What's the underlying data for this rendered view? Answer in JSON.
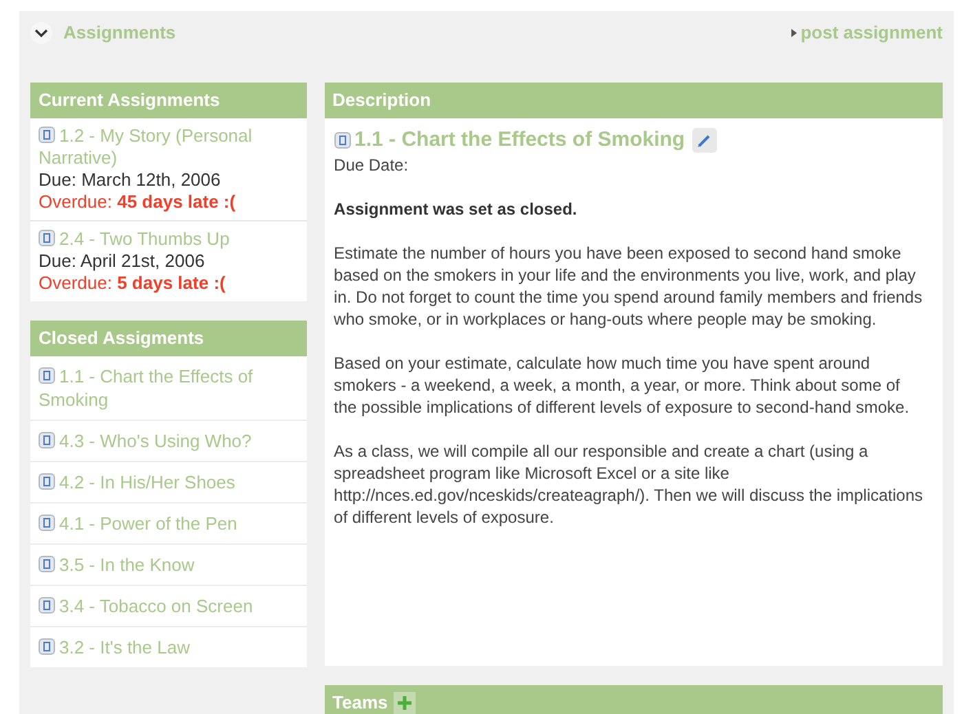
{
  "header": {
    "title": "Assignments",
    "expanded": true,
    "action": "post assignment"
  },
  "current": {
    "title": "Current Assignments",
    "items": [
      {
        "title": "1.2 - My Story (Personal Narrative)",
        "due": "Due: March 12th, 2006",
        "overdue": "Overdue: **45 days late :(**"
      },
      {
        "title": "2.4 - Two Thumbs Up",
        "due": "Due: April 21st, 2006",
        "overdue": "Overdue: **5 days late :(**"
      }
    ]
  },
  "closed": {
    "title": "Closed Assigments",
    "items": [
      {
        "title": "1.1 - Chart the Effects of Smoking"
      },
      {
        "title": "4.3 - Who's Using Who?"
      },
      {
        "title": "4.2 - In His/Her Shoes"
      },
      {
        "title": "4.1 - Power of the Pen"
      },
      {
        "title": "3.5 - In the Know"
      },
      {
        "title": "3.4 - Tobacco on Screen"
      },
      {
        "title": "3.2 - It's the Law"
      }
    ]
  },
  "description": {
    "title": "Description",
    "assignment": "1.1 - Chart the Effects of Smoking",
    "due": "Due Date:",
    "status": "Assignment was set as closed.",
    "paragraphs": [
      "Estimate the number of hours you have been exposed to second hand smoke based on the smokers in your life and the environments you live, work, and play in. Do not forget to count the time you spend around family members and friends who smoke, or in workplaces or hang-outs where people may be smoking.",
      "Based on your estimate, calculate how much time you have spent around smokers - a weekend, a week, a month, a year, or more. Think about some of the possible implications of different levels of exposure to second-hand smoke.",
      "As a class, we will compile all our responsible and create a chart (using a spreadsheet program like Microsoft Excel or a site like http://nces.ed.gov/nceskids/createagraph/). Then we will discuss the implications of different levels of exposure."
    ]
  },
  "teams": {
    "title": "Teams"
  }
}
